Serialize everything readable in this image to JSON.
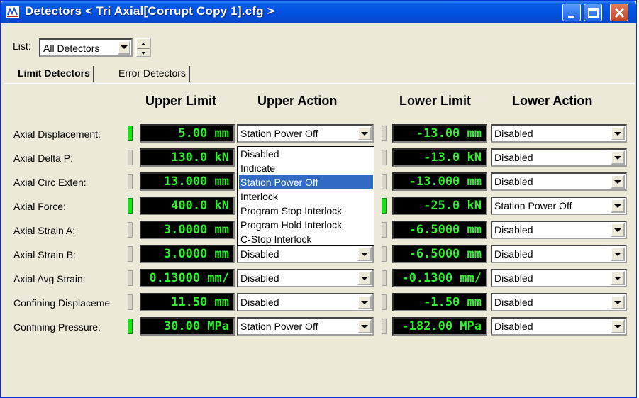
{
  "window": {
    "title": "Detectors < Tri Axial[Corrupt Copy 1].cfg >"
  },
  "list": {
    "label": "List:",
    "value": "All Detectors"
  },
  "tabs": [
    {
      "label": "Limit Detectors",
      "active": true
    },
    {
      "label": "Error Detectors",
      "active": false
    }
  ],
  "columns": {
    "upper_limit": "Upper Limit",
    "upper_action": "Upper Action",
    "lower_limit": "Lower Limit",
    "lower_action": "Lower Action"
  },
  "rows": [
    {
      "label": "Axial Displacement:",
      "upper_on": true,
      "upper_limit": "5.00  mm",
      "upper_action": "Station Power Off",
      "lower_on": false,
      "lower_limit": "-13.00  mm",
      "lower_action": "Disabled"
    },
    {
      "label": "Axial Delta P:",
      "upper_on": false,
      "upper_limit": "130.0  kN",
      "upper_action": "",
      "lower_on": false,
      "lower_limit": "-13.0  kN",
      "lower_action": "Disabled"
    },
    {
      "label": "Axial Circ Exten:",
      "upper_on": false,
      "upper_limit": "13.000  mm",
      "upper_action": "",
      "lower_on": false,
      "lower_limit": "-13.000  mm",
      "lower_action": "Disabled"
    },
    {
      "label": "Axial Force:",
      "upper_on": true,
      "upper_limit": "400.0  kN",
      "upper_action": "",
      "lower_on": true,
      "lower_limit": "-25.0  kN",
      "lower_action": "Station Power Off"
    },
    {
      "label": "Axial Strain A:",
      "upper_on": false,
      "upper_limit": "3.0000  mm",
      "upper_action": "",
      "lower_on": false,
      "lower_limit": "-6.5000  mm",
      "lower_action": "Disabled"
    },
    {
      "label": "Axial Strain B:",
      "upper_on": false,
      "upper_limit": "3.0000  mm",
      "upper_action": "Disabled",
      "lower_on": false,
      "lower_limit": "-6.5000  mm",
      "lower_action": "Disabled"
    },
    {
      "label": "Axial Avg Strain:",
      "upper_on": false,
      "upper_limit": "0.13000  mm/",
      "upper_action": "Disabled",
      "lower_on": false,
      "lower_limit": "-0.1300  mm/",
      "lower_action": "Disabled"
    },
    {
      "label": "Confining Displaceme",
      "upper_on": false,
      "upper_limit": "11.50  mm",
      "upper_action": "Disabled",
      "lower_on": false,
      "lower_limit": "-1.50  mm",
      "lower_action": "Disabled"
    },
    {
      "label": "Confining Pressure:",
      "upper_on": true,
      "upper_limit": "30.00  MPa",
      "upper_action": "Station Power Off",
      "lower_on": false,
      "lower_limit": "-182.00  MPa",
      "lower_action": "Disabled"
    }
  ],
  "dropdown": {
    "options": [
      "Disabled",
      "Indicate",
      "Station Power Off",
      "Interlock",
      "Program Stop Interlock",
      "Program Hold Interlock",
      "C-Stop Interlock"
    ],
    "selected": "Station Power Off"
  },
  "colors": {
    "lcd_text": "#30f030",
    "indicator_on": "#17e317",
    "selection": "#316ac5",
    "titlebar": "#0050e0"
  }
}
